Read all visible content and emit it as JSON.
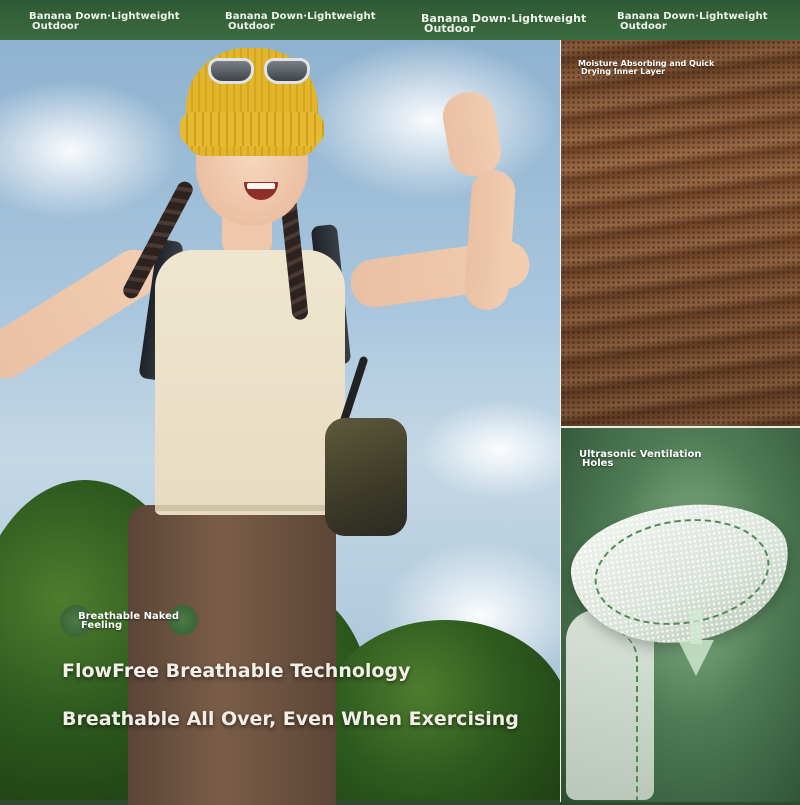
{
  "top_banner": {
    "tags": [
      {
        "line1": "Banana Down·Lightweight",
        "line2": "Outdoor"
      },
      {
        "line1": "Banana Down·Lightweight",
        "line2": "Outdoor"
      },
      {
        "line1": "Banana Down·Lightweight",
        "line2": "Outdoor"
      },
      {
        "line1": "Banana Down·Lightweight",
        "line2": "Outdoor"
      }
    ]
  },
  "scene": {
    "feature_label": {
      "line1": "Breathable Naked",
      "line2": "Feeling"
    },
    "headline1": "FlowFree Breathable Technology",
    "headline2": "Breathable All Over, Even When Exercising"
  },
  "fabric_panel": {
    "label": {
      "line1": "Moisture Absorbing and Quick",
      "line2": "Drying Inner Layer"
    }
  },
  "vent_panel": {
    "label": {
      "line1": "Ultrasonic Ventilation",
      "line2": "Holes"
    }
  },
  "colors": {
    "banner_green": "#2f5a34",
    "fabric_brown": "#8a5a38",
    "vent_green": "#4f7c54",
    "text_light": "#f2efe6"
  }
}
